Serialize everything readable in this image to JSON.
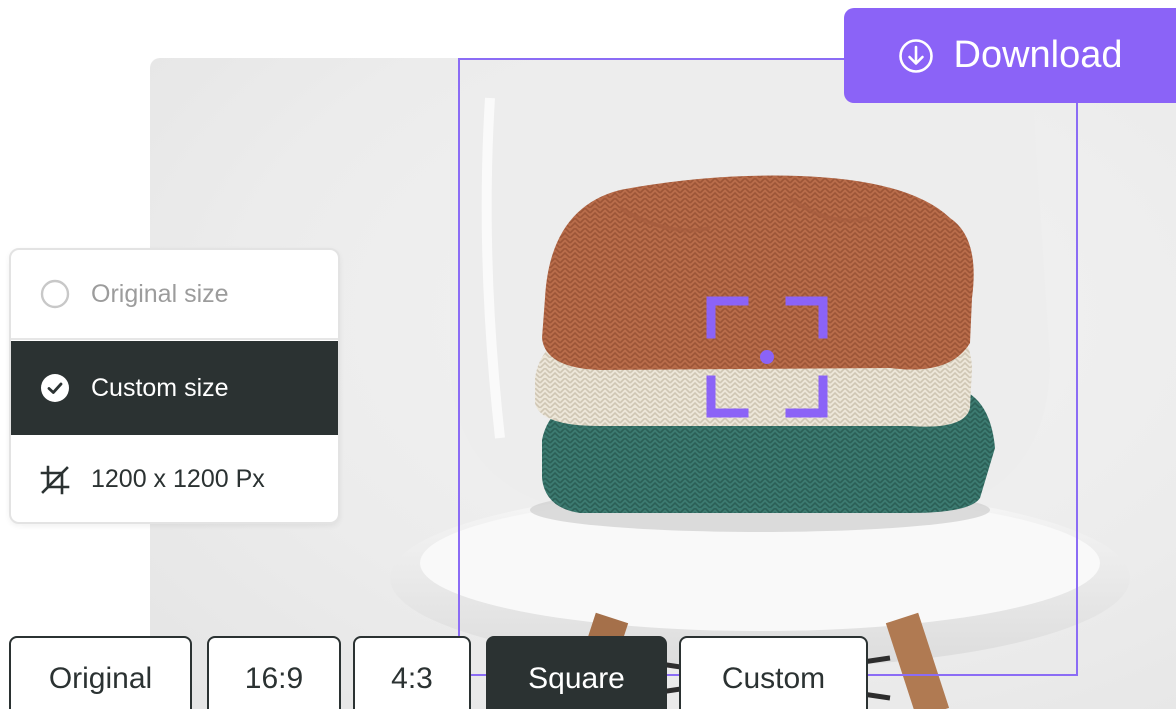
{
  "actions": {
    "download_label": "Download"
  },
  "size_panel": {
    "original_label": "Original size",
    "custom_label": "Custom size",
    "dimensions_label": "1200 x 1200 Px",
    "selected": "custom"
  },
  "aspect_tabs": {
    "items": [
      {
        "label": "Original"
      },
      {
        "label": "16:9"
      },
      {
        "label": "4:3"
      },
      {
        "label": "Square"
      },
      {
        "label": "Custom"
      }
    ],
    "active": "Square"
  },
  "icons": {
    "download": "download-circle-icon",
    "radio_empty": "radio-unchecked-icon",
    "radio_checked": "check-circle-icon",
    "crop": "crop-icon",
    "focus": "focus-target-icon"
  },
  "colors": {
    "accent": "#8b63f7",
    "dark": "#2b3232",
    "muted": "#9c9c9c"
  }
}
